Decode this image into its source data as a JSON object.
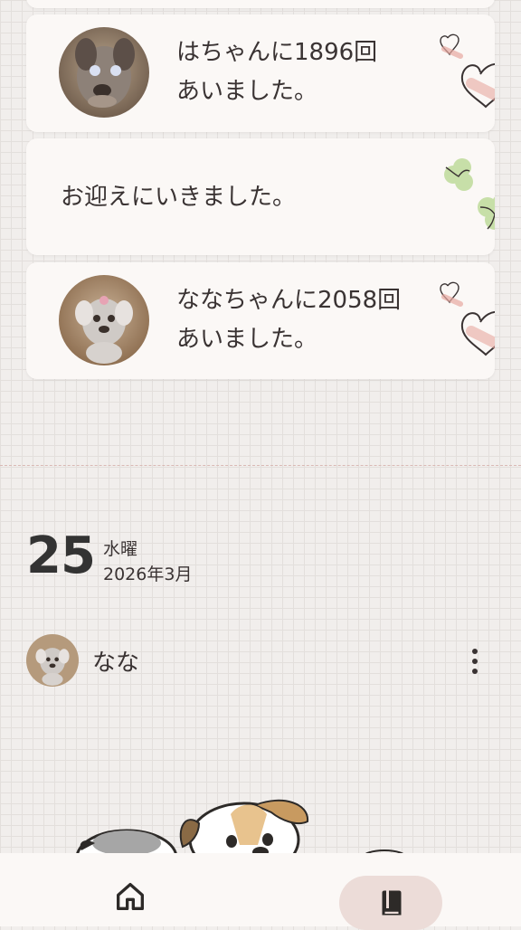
{
  "timeline_cards": [
    {
      "text_line1": "はちゃんに1896回",
      "text_line2": "あいました。",
      "avatar": "dog-photo-hachi",
      "decoration": "heart-icon"
    },
    {
      "text_line1": "お迎えにいきました。",
      "avatar": null,
      "decoration": "clover-icon"
    },
    {
      "text_line1": "ななちゃんに2058回",
      "text_line2": "あいました。",
      "avatar": "dog-photo-nana",
      "decoration": "heart-icon"
    }
  ],
  "date_header": {
    "day": "25",
    "weekday": "水曜",
    "year_month": "2026年3月"
  },
  "entry": {
    "user_name": "なな",
    "menu_icon": "more-vertical-icon"
  },
  "bottom_nav": {
    "home_icon": "home-icon",
    "diary_icon": "book-icon",
    "active": "diary"
  },
  "colors": {
    "background": "#f1eeec",
    "card": "#fbf8f6",
    "accent_pink": "#ecdcd8",
    "divider": "#d9b9b4"
  }
}
